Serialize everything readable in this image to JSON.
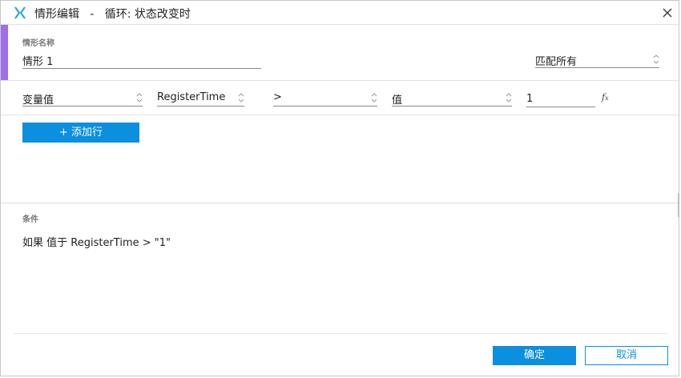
{
  "window": {
    "title": "情形编辑   -   循环: 状态改变时"
  },
  "scenario": {
    "name_label": "情形名称",
    "name_value": "情形 1",
    "match_mode": "匹配所有"
  },
  "condition_row": {
    "source_type": "变量值",
    "variable": "RegisterTime",
    "operator": ">",
    "value_type": "值",
    "value": "1"
  },
  "add_row_label": "+ 添加行",
  "conditions": {
    "label": "条件",
    "text": "如果 值于 RegisterTime > \"1\""
  },
  "footer": {
    "ok_label": "确定",
    "cancel_label": "取消"
  },
  "colors": {
    "accent_purple": "#a06ee6",
    "primary_blue": "#0b8fdf",
    "logo_blue": "#1ea0e8"
  },
  "icons": {
    "logo": "axure-x-icon",
    "close": "close-icon",
    "select_arrows": "updown-chevron-icon",
    "formula": "fx-icon"
  }
}
